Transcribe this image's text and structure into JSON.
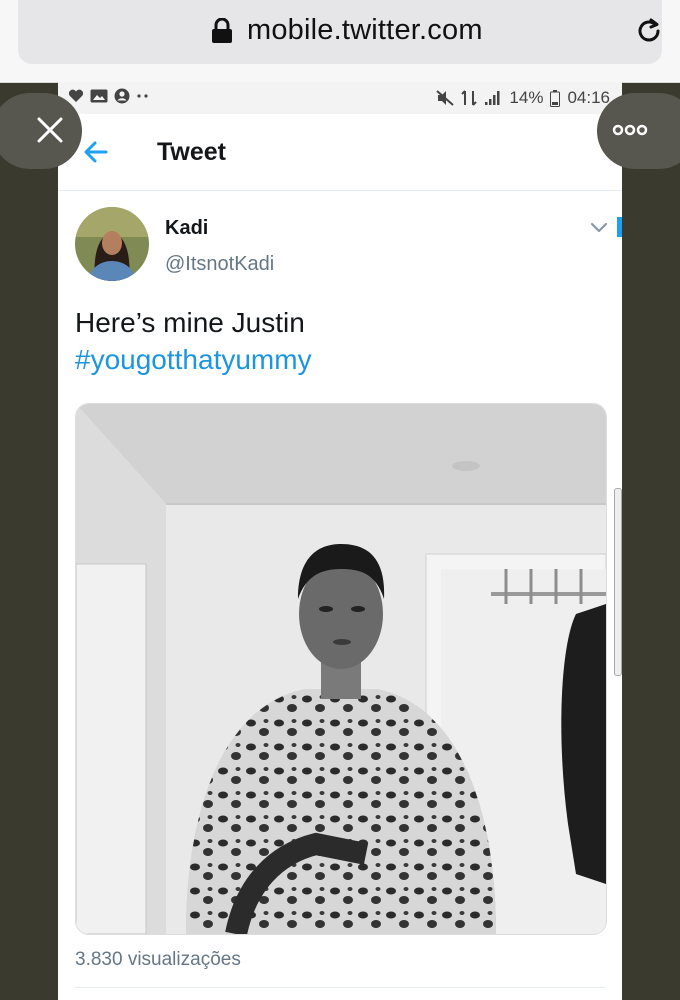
{
  "browser": {
    "url": "mobile.twitter.com",
    "lock_icon": "lock-icon",
    "reload_icon": "reload-icon"
  },
  "status_bar": {
    "battery": "14%",
    "time": "04:16"
  },
  "header": {
    "title": "Tweet",
    "back_icon": "arrow-left-icon"
  },
  "tweet": {
    "author_name": "Kadi",
    "author_handle": "@ItsnotKadi",
    "text": "Here’s mine Justin",
    "hashtag": "#yougotthatyummy",
    "views": "3.830 visualizações"
  },
  "overlay": {
    "close_icon": "close-icon",
    "more_icon": "more-icon"
  },
  "colors": {
    "link": "#1b95e0",
    "accent": "#1da1f2",
    "background": "#3b3a2f"
  }
}
